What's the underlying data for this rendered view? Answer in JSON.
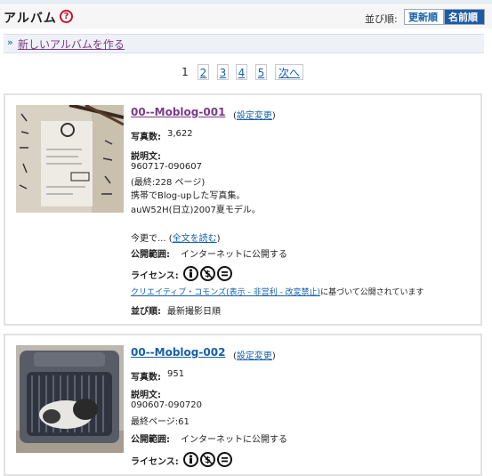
{
  "header": {
    "title": "アルバム",
    "help_icon": "?",
    "sort_label": "並び順:",
    "sort_updated": "更新順",
    "sort_name": "名前順"
  },
  "new_album": {
    "chevron": "»",
    "label": "新しいアルバムを作る"
  },
  "pager": {
    "current": "1",
    "pages": [
      "2",
      "3",
      "4",
      "5"
    ],
    "next": "次へ"
  },
  "albums": [
    {
      "title": "00--Moblog-001",
      "settings": "設定変更",
      "photo_count_label": "写真数:",
      "photo_count": "3,622",
      "desc_label": "説明文:",
      "desc_lines": [
        "960717-090607",
        "(最終:228 ページ)",
        "携帯でBlog-upした写真集。",
        "auW52H(日立)2007夏モデル。"
      ],
      "more_prefix": "今更で...",
      "more_link": "全文を読む",
      "scope_label": "公開範囲:",
      "scope": "インターネットに公開する",
      "license_label": "ライセンス:",
      "license_link": "クリエイティブ・コモンズ(表示 - 非営利 - 改変禁止)",
      "license_suffix": "に基づいて公開されています",
      "order_label": "並び順:",
      "order": "最新撮影日順"
    },
    {
      "title": "00--Moblog-002",
      "settings": "設定変更",
      "photo_count_label": "写真数:",
      "photo_count": "951",
      "desc_label": "説明文:",
      "desc_lines": [
        "090607-090720",
        "最終ページ:61"
      ],
      "scope_label": "公開範囲:",
      "scope": "インターネットに公開する",
      "license_label": "ライセンス:"
    }
  ]
}
